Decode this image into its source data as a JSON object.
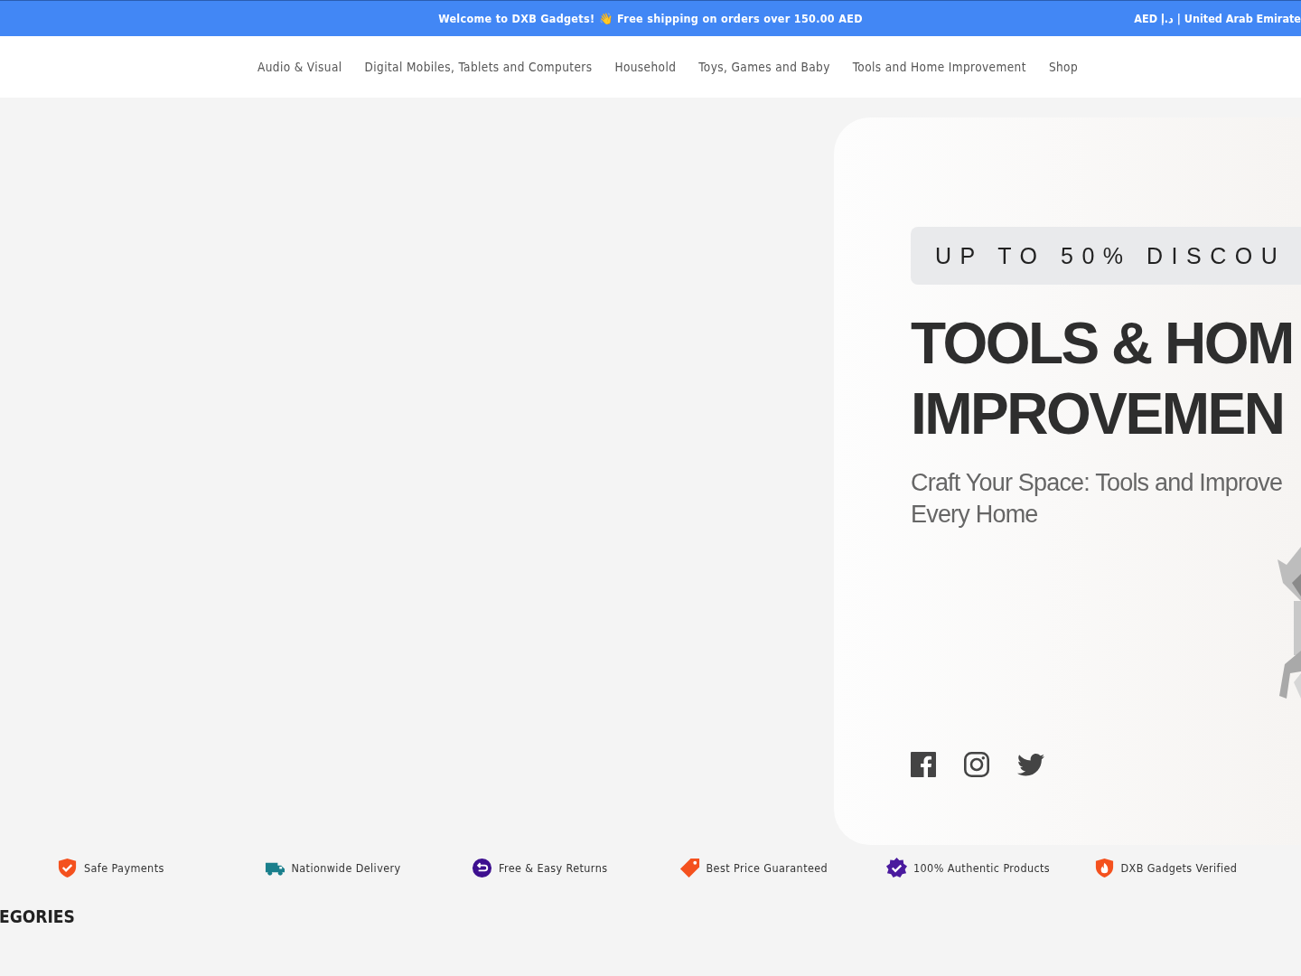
{
  "announcement": {
    "text": "Welcome to DXB Gadgets! 👋 Free shipping on orders over 150.00 AED",
    "locale": "AED د.إ | United Arab Emirate"
  },
  "nav": [
    "Audio & Visual",
    "Digital Mobiles, Tablets and Computers",
    "Household",
    "Toys, Games and Baby",
    "Tools and Home Improvement",
    "Shop"
  ],
  "hero": {
    "badge": "UP TO 50% DISCOU",
    "title_lines": [
      "TOOLS & HOM",
      "IMPROVEMEN"
    ],
    "subtitle_lines": [
      "Craft Your Space: Tools and Improve",
      "Every Home"
    ],
    "social": [
      {
        "kind": "facebook"
      },
      {
        "kind": "instagram"
      },
      {
        "kind": "twitter"
      }
    ]
  },
  "features": [
    {
      "label": "Safe Payments",
      "kind": "shield",
      "color": "#f4511e"
    },
    {
      "label": "Nationwide Delivery",
      "kind": "truck",
      "color": "#1a7f8c"
    },
    {
      "label": "Free & Easy Returns",
      "kind": "return",
      "color": "#3d0f8f"
    },
    {
      "label": "Best Price Guaranteed",
      "kind": "tag",
      "color": "#f4511e"
    },
    {
      "label": "100% Authentic Products",
      "kind": "badge",
      "color": "#4a1a9e"
    },
    {
      "label": "DXB Gadgets Verified",
      "kind": "flame",
      "color": "#f4511e"
    }
  ],
  "section_heading": "EGORIES"
}
